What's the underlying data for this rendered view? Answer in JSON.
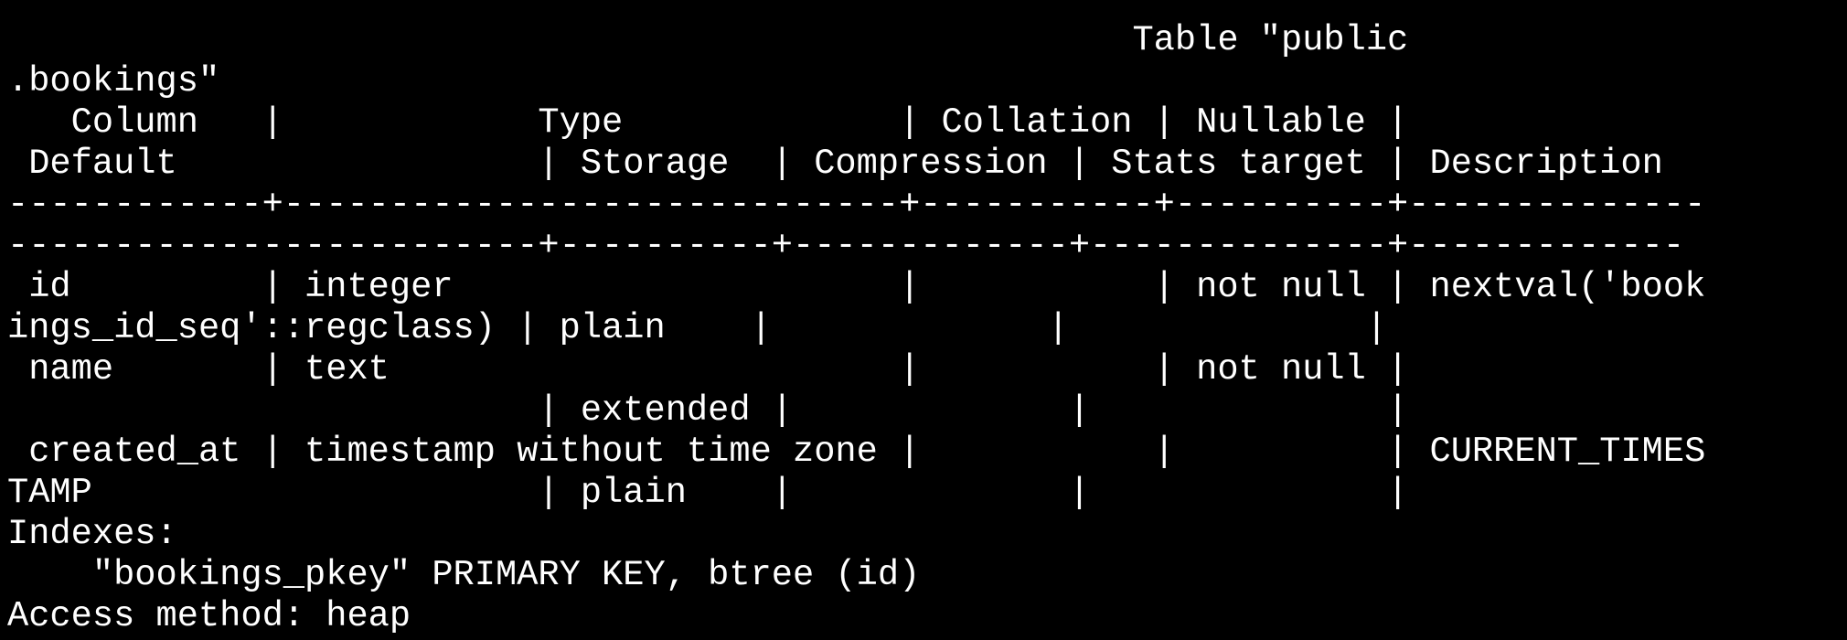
{
  "terminal": {
    "background": "#000000",
    "foreground": "#ffffff",
    "partial_top": "~",
    "lines": [
      "                                                     Table \"public",
      ".bookings\"",
      "   Column   |            Type             | Collation | Nullable |",
      " Default                 | Storage  | Compression | Stats target | Description",
      "------------+-----------------------------+-----------+----------+--------------",
      "-------------------------+----------+-------------+--------------+-------------",
      " id         | integer                     |           | not null | nextval('book",
      "ings_id_seq'::regclass) | plain    |             |              |",
      " name       | text                        |           | not null |",
      "                         | extended |             |              |",
      " created_at | timestamp without time zone |           |          | CURRENT_TIMES",
      "TAMP                     | plain    |             |              |",
      "Indexes:",
      "    \"bookings_pkey\" PRIMARY KEY, btree (id)",
      "Access method: heap"
    ]
  }
}
